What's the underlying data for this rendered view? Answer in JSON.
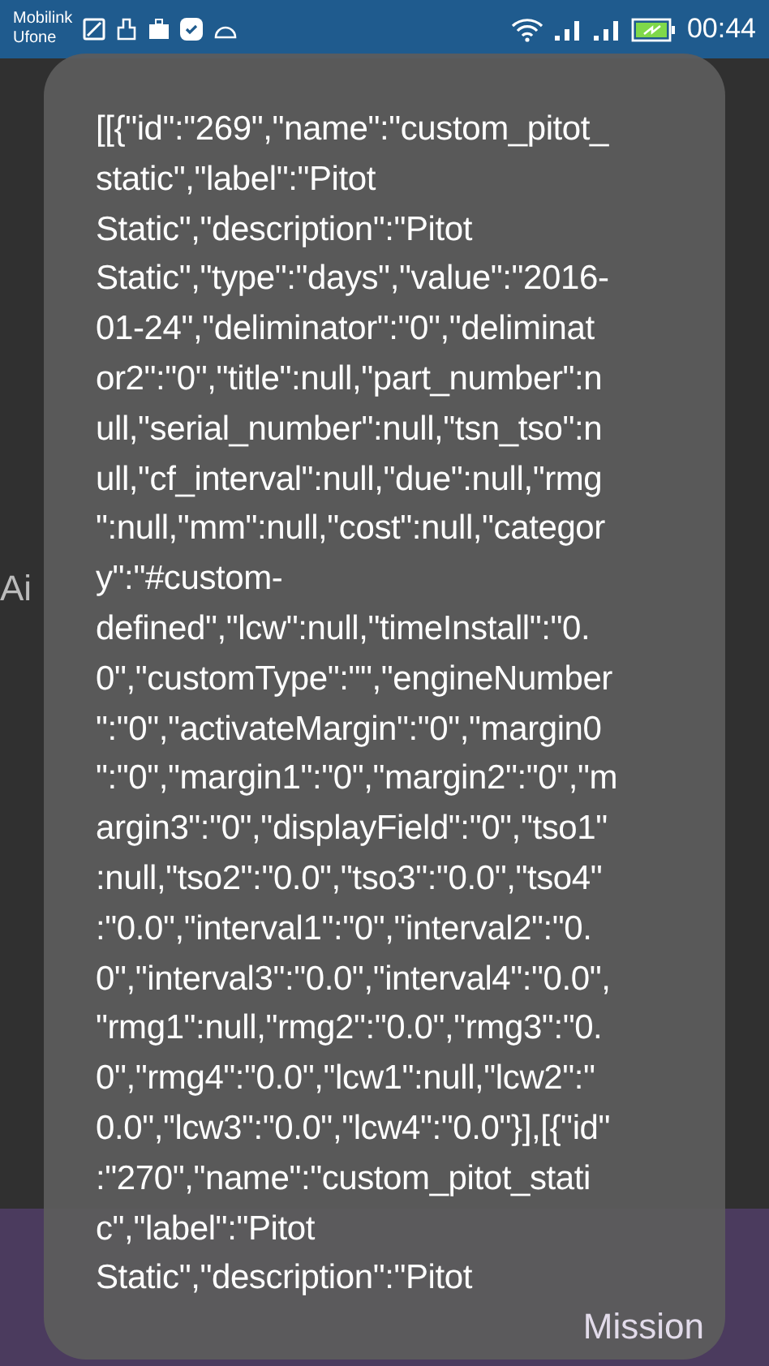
{
  "status_bar": {
    "carriers": [
      "Mobilink",
      "Ufone"
    ],
    "time": "00:44"
  },
  "background": {
    "side_text": "Ai",
    "nav_label": "Mission"
  },
  "toast": {
    "lines": [
      "[[{\"id\":\"269\",\"name\":\"custom_pitot_",
      "static\",\"label\":\"Pitot",
      "Static\",\"description\":\"Pitot",
      "Static\",\"type\":\"days\",\"value\":\"2016-",
      "01-24\",\"deliminator\":\"0\",\"deliminat",
      "or2\":\"0\",\"title\":null,\"part_number\":n",
      "ull,\"serial_number\":null,\"tsn_tso\":n",
      "ull,\"cf_interval\":null,\"due\":null,\"rmg",
      "\":null,\"mm\":null,\"cost\":null,\"categor",
      "y\":\"#custom-",
      "defined\",\"lcw\":null,\"timeInstall\":\"0.",
      "0\",\"customType\":\"\",\"engineNumber",
      "\":\"0\",\"activateMargin\":\"0\",\"margin0",
      "\":\"0\",\"margin1\":\"0\",\"margin2\":\"0\",\"m",
      "argin3\":\"0\",\"displayField\":\"0\",\"tso1\"",
      ":null,\"tso2\":\"0.0\",\"tso3\":\"0.0\",\"tso4\"",
      ":\"0.0\",\"interval1\":\"0\",\"interval2\":\"0.",
      "0\",\"interval3\":\"0.0\",\"interval4\":\"0.0\",",
      "\"rmg1\":null,\"rmg2\":\"0.0\",\"rmg3\":\"0.",
      "0\",\"rmg4\":\"0.0\",\"lcw1\":null,\"lcw2\":\"",
      "0.0\",\"lcw3\":\"0.0\",\"lcw4\":\"0.0\"}],[{\"id\"",
      ":\"270\",\"name\":\"custom_pitot_stati",
      "c\",\"label\":\"Pitot",
      "Static\",\"description\":\"Pitot"
    ]
  }
}
